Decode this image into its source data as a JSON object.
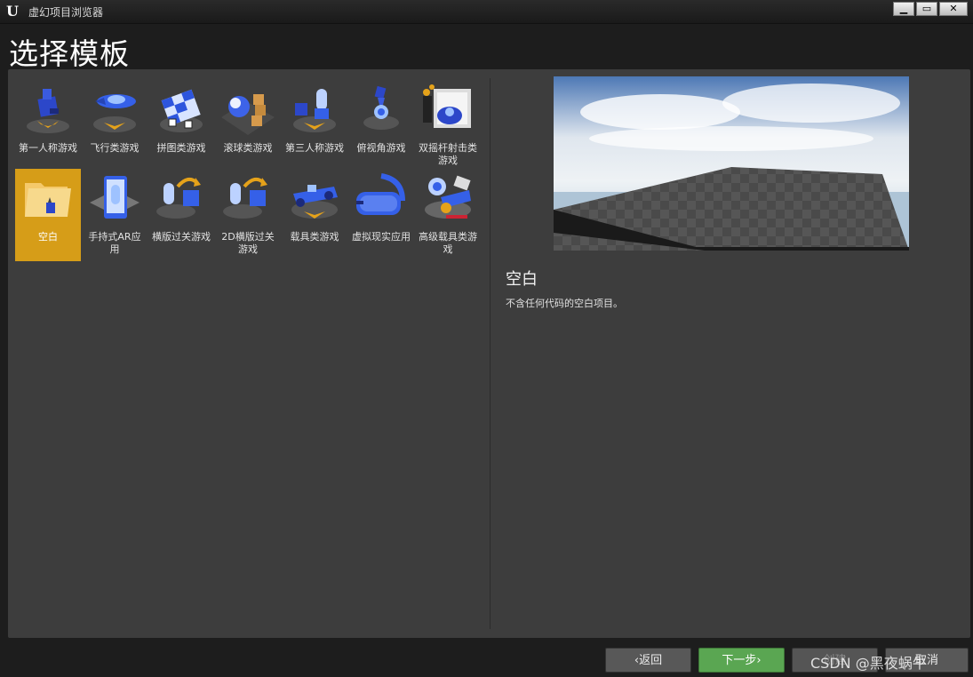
{
  "window": {
    "title": "虚幻项目浏览器",
    "minimize": "▁",
    "maximize": "▭",
    "close": "✕",
    "logo": "U"
  },
  "heading": "选择模板",
  "templates": [
    {
      "label": "第一人称游戏",
      "icon": "first-person-icon",
      "selected": false
    },
    {
      "label": "飞行类游戏",
      "icon": "flying-icon",
      "selected": false
    },
    {
      "label": "拼图类游戏",
      "icon": "puzzle-icon",
      "selected": false
    },
    {
      "label": "滚球类游戏",
      "icon": "rolling-ball-icon",
      "selected": false
    },
    {
      "label": "第三人称游戏",
      "icon": "third-person-icon",
      "selected": false
    },
    {
      "label": "俯视角游戏",
      "icon": "top-down-icon",
      "selected": false
    },
    {
      "label": "双摇杆射击类游戏",
      "icon": "twin-stick-icon",
      "selected": false
    },
    {
      "label": "空白",
      "icon": "blank-folder-icon",
      "selected": true
    },
    {
      "label": "手持式AR应用",
      "icon": "handheld-ar-icon",
      "selected": false
    },
    {
      "label": "横版过关游戏",
      "icon": "side-scroller-icon",
      "selected": false
    },
    {
      "label": "2D横版过关游戏",
      "icon": "side-scroller-2d-icon",
      "selected": false
    },
    {
      "label": "载具类游戏",
      "icon": "vehicle-icon",
      "selected": false
    },
    {
      "label": "虚拟现实应用",
      "icon": "vr-headset-icon",
      "selected": false
    },
    {
      "label": "高级载具类游戏",
      "icon": "advanced-vehicle-icon",
      "selected": false
    }
  ],
  "details": {
    "title": "空白",
    "description": "不含任何代码的空白项目。"
  },
  "buttons": {
    "back": "‹返回",
    "next": "下一步›",
    "create": "创建",
    "cancel": "取消"
  },
  "watermark": "CSDN @黑夜蜗牛",
  "colors": {
    "selected": "#d69d18",
    "next_button": "#5aa652",
    "panel": "#3d3d3d"
  }
}
